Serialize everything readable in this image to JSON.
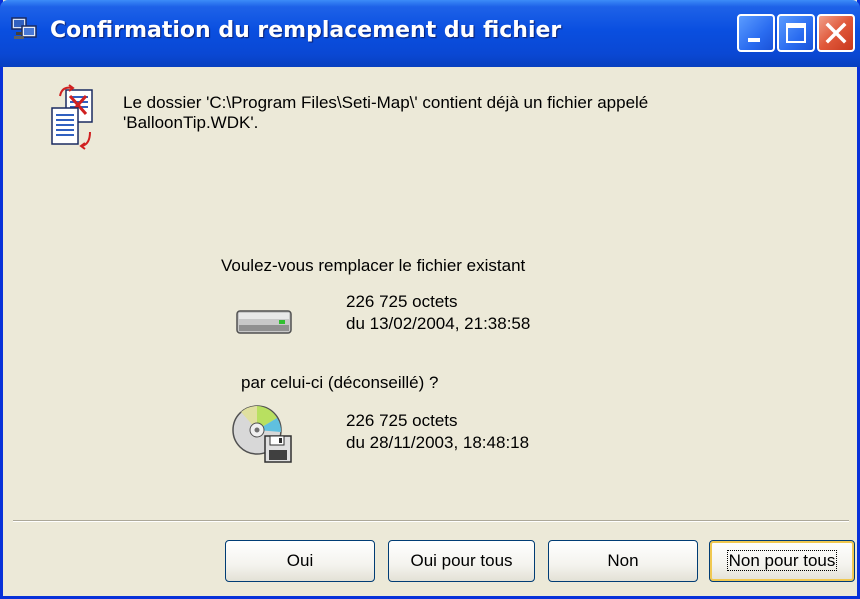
{
  "window": {
    "title": "Confirmation du remplacement du fichier",
    "icon": "file-transfer-icon"
  },
  "titlebar_buttons": {
    "minimize": "minimize-icon",
    "maximize": "maximize-icon",
    "close": "close-icon"
  },
  "message": {
    "line1": "Le dossier 'C:\\Program Files\\Seti-Map\\' contient déjà un fichier appelé",
    "line2": "'BalloonTip.WDK'.",
    "icon": "file-replace-icon"
  },
  "question": "Voulez-vous remplacer le fichier existant",
  "existing_file": {
    "icon": "hard-drive-icon",
    "size": "226 725 octets",
    "date": "du 13/02/2004, 21:38:58"
  },
  "replace_question": "par celui-ci (déconseillé) ?",
  "new_file": {
    "icon": "cd-floppy-icon",
    "size": "226 725 octets",
    "date": "du 28/11/2003, 18:48:18"
  },
  "buttons": {
    "yes": "Oui",
    "yes_all": "Oui pour tous",
    "no": "Non",
    "no_all": "Non pour tous"
  },
  "colors": {
    "titlebar": "#0a4fe0",
    "dialog_bg": "#ece9d8",
    "close_button": "#e0583a",
    "default_button_focus": "#f0c850"
  }
}
